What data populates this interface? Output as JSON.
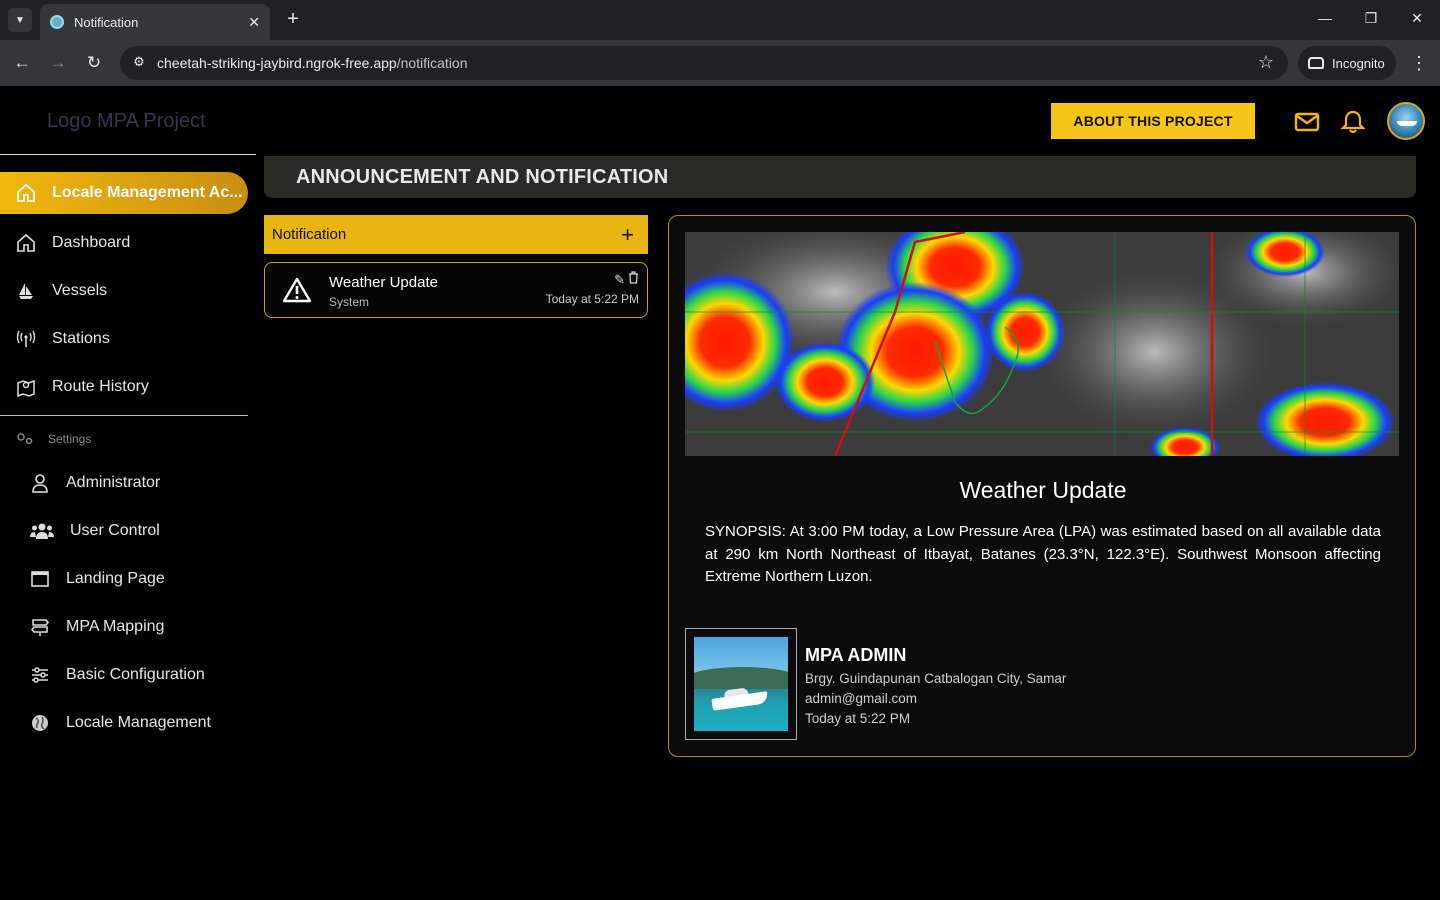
{
  "browser": {
    "tab_title": "Notification",
    "url_host": "cheetah-striking-jaybird.ngrok-free.app",
    "url_path": "/notification",
    "incognito_label": "Incognito"
  },
  "header": {
    "logo_text": "Logo MPA Project",
    "about_button": "ABOUT THIS PROJECT"
  },
  "sidebar": {
    "active_item": "Locale Management Ac...",
    "items": [
      {
        "label": "Dashboard",
        "icon": "home-icon"
      },
      {
        "label": "Vessels",
        "icon": "ship-icon"
      },
      {
        "label": "Stations",
        "icon": "antenna-icon"
      },
      {
        "label": "Route History",
        "icon": "map-pin-icon"
      }
    ],
    "settings_label": "Settings",
    "settings_items": [
      {
        "label": "Administrator",
        "icon": "user-icon"
      },
      {
        "label": "User Control",
        "icon": "users-icon"
      },
      {
        "label": "Landing Page",
        "icon": "window-icon"
      },
      {
        "label": "MPA Mapping",
        "icon": "signpost-icon"
      },
      {
        "label": "Basic Configuration",
        "icon": "sliders-icon"
      },
      {
        "label": "Locale Management",
        "icon": "globe-icon"
      }
    ]
  },
  "page": {
    "title": "ANNOUNCEMENT AND NOTIFICATION"
  },
  "notifications": {
    "header_label": "Notification",
    "items": [
      {
        "title": "Weather Update",
        "source": "System",
        "time": "Today at 5:22 PM"
      }
    ]
  },
  "detail": {
    "title": "Weather Update",
    "body": "SYNOPSIS: At 3:00 PM today, a Low Pressure Area (LPA) was estimated based on all available data at 290 km North Northeast of Itbayat, Batanes (23.3°N, 122.3°E). Southwest Monsoon affecting Extreme Northern Luzon.",
    "author": {
      "name": "MPA ADMIN",
      "address": "Brgy. Guindapunan Catbalogan City, Samar",
      "email": "admin@gmail.com",
      "time": "Today at 5:22 PM"
    }
  },
  "colors": {
    "accent": "#f5c518",
    "border": "#b08a2c",
    "background": "#000000"
  }
}
